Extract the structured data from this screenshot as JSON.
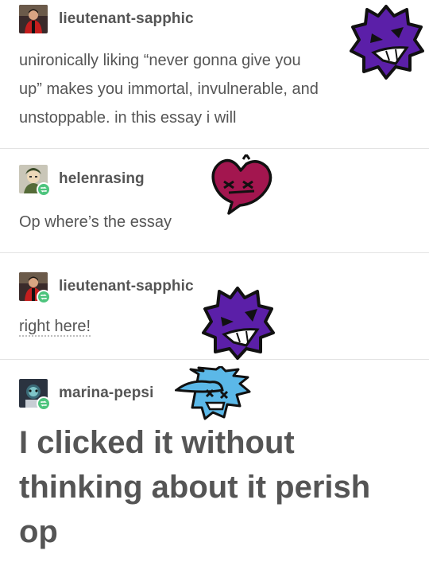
{
  "posts": [
    {
      "username": "lieutenant-sapphic",
      "lines": [
        "unironically liking “never gonna give you",
        "up” makes you immortal, invulnerable, and",
        "unstoppable. in this essay i will"
      ]
    },
    {
      "username": "helenrasing",
      "lines": [
        "Op where’s the essay"
      ]
    },
    {
      "username": "lieutenant-sapphic",
      "link_text": "right here!"
    },
    {
      "username": "marina-pepsi",
      "lines": [
        "I clicked it without",
        "thinking about it perish",
        "op"
      ]
    }
  ],
  "icons": {
    "reblog": "reblog-icon",
    "sticker_purple": "purple-spiky-face-icon",
    "sticker_heart": "magenta-heart-face-icon",
    "sticker_blue": "blue-cap-face-icon"
  },
  "colors": {
    "reblog": "#4dc47d",
    "purple": "#5b1fa8",
    "magenta": "#a3164f",
    "blue": "#5bb8e8"
  }
}
